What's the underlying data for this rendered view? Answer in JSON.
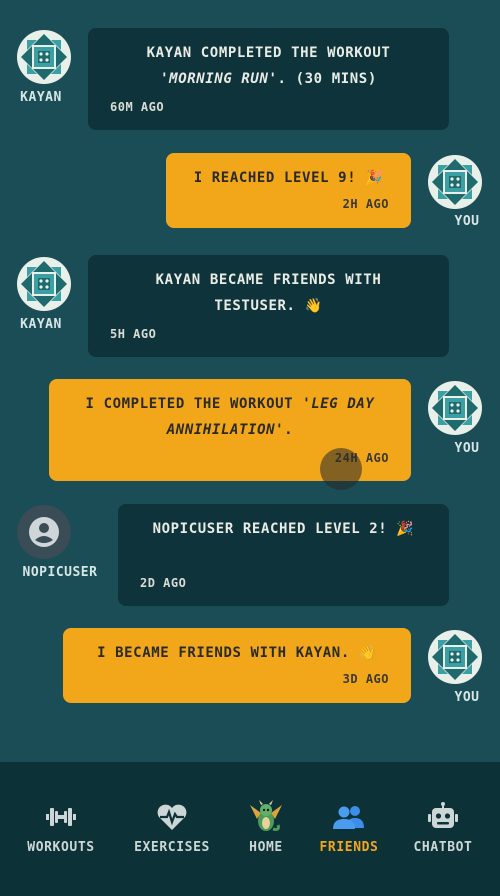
{
  "messages": [
    {
      "user": "KAYAN",
      "text_parts": [
        "KAYAN COMPLETED THE WORKOUT '",
        "MORNING RUN",
        "'. (30 MINS)"
      ],
      "time": "60M AGO",
      "mine": false,
      "avatar": "quilt-pattern-avatar"
    },
    {
      "user": "YOU",
      "text": "I REACHED LEVEL 9! 🎉",
      "time": "2H AGO",
      "mine": true,
      "avatar": "quilt-pattern-avatar"
    },
    {
      "user": "KAYAN",
      "text": "KAYAN BECAME FRIENDS WITH TESTUSER. 👋",
      "time": "5H AGO",
      "mine": false,
      "avatar": "quilt-pattern-avatar"
    },
    {
      "user": "YOU",
      "text_parts": [
        "I COMPLETED THE WORKOUT '",
        "LEG DAY ANNIHILATION",
        "'."
      ],
      "time": "24H AGO",
      "mine": true,
      "avatar": "quilt-pattern-avatar"
    },
    {
      "user": "NOPICUSER",
      "text": "NOPICUSER REACHED LEVEL 2! 🎉",
      "time": "2D AGO",
      "mine": false,
      "avatar": "default-person-avatar"
    },
    {
      "user": "YOU",
      "text": "I BECAME FRIENDS WITH KAYAN. 👋",
      "time": "3D AGO",
      "mine": true,
      "avatar": "quilt-pattern-avatar"
    }
  ],
  "nav": {
    "active": "FRIENDS",
    "accent": "#f2a71b",
    "items": [
      {
        "label": "WORKOUTS",
        "icon": "dumbbell-icon"
      },
      {
        "label": "EXERCISES",
        "icon": "heart-pulse-icon"
      },
      {
        "label": "HOME",
        "icon": "dragon-icon"
      },
      {
        "label": "FRIENDS",
        "icon": "people-icon"
      },
      {
        "label": "CHATBOT",
        "icon": "robot-icon"
      }
    ]
  },
  "colors": {
    "background": "#1a4d55",
    "bubble_other": "#0e333a",
    "bubble_mine": "#f2a71b",
    "navbar": "#0c3238"
  }
}
